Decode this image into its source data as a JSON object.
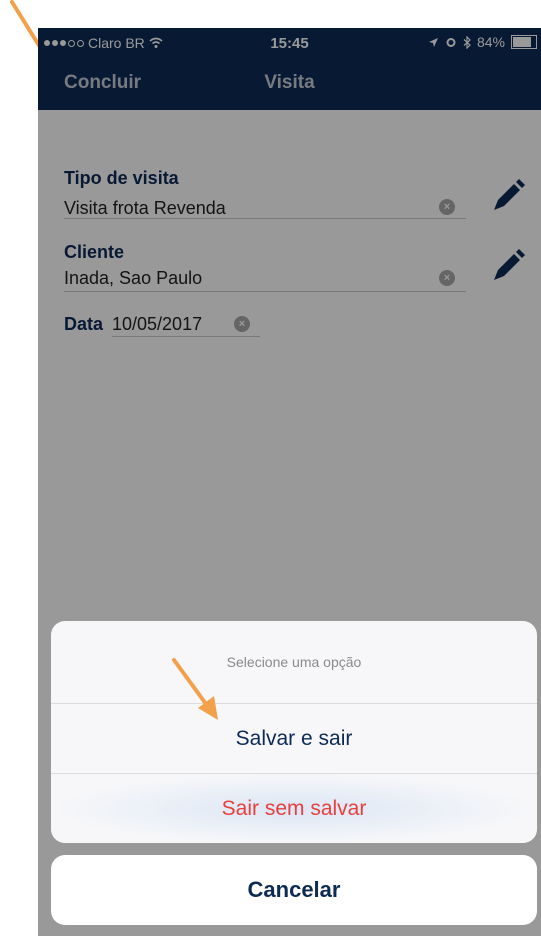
{
  "status_bar": {
    "carrier": "Claro BR",
    "time": "15:45",
    "battery": "84%",
    "battery_level": 0.84,
    "signal_bars_filled": 3,
    "signal_bars_total": 5
  },
  "navbar": {
    "done_label": "Concluir",
    "title": "Visita"
  },
  "form": {
    "tipo_label": "Tipo de visita",
    "tipo_value": "Visita frota Revenda",
    "cliente_label": "Cliente",
    "cliente_value": "Inada, Sao Paulo",
    "data_label": "Data",
    "data_value": "10/05/2017"
  },
  "action_sheet": {
    "title": "Selecione uma opção",
    "save_label": "Salvar e sair",
    "discard_label": "Sair sem salvar",
    "cancel_label": "Cancelar"
  },
  "colors": {
    "brand_navy": "#0d2a55",
    "destructive_red": "#e8403d",
    "annotation_arrow": "#f2a04a"
  },
  "icons": [
    "wifi-icon",
    "location-icon",
    "alarm-icon",
    "bluetooth-icon",
    "battery-icon",
    "clear-icon",
    "pencil-icon",
    "arrow-annotation"
  ]
}
